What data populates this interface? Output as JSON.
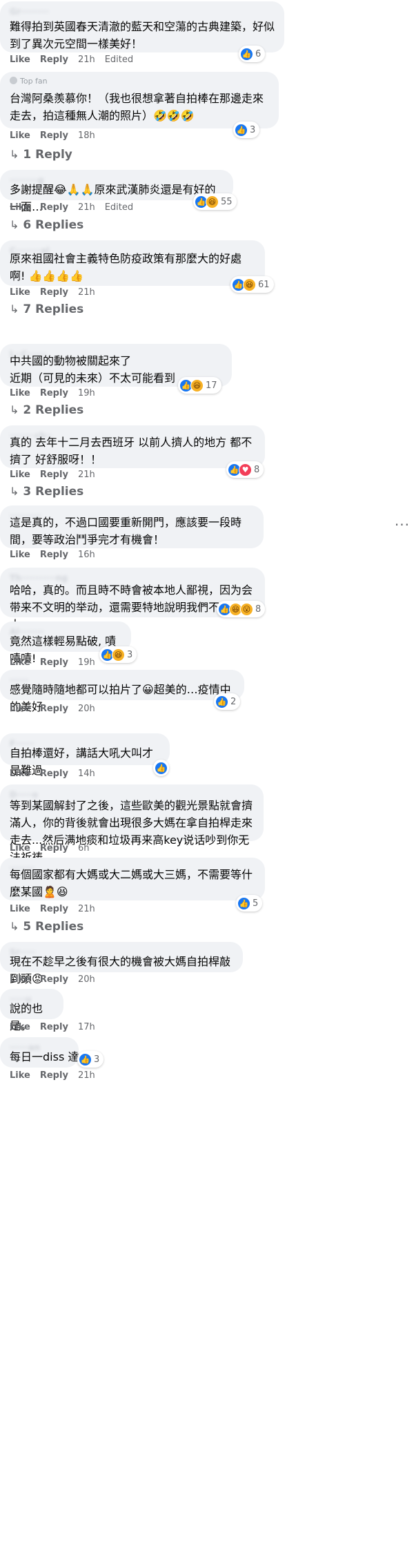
{
  "labels": {
    "like": "Like",
    "reply": "Reply"
  },
  "comments": [
    {
      "text": "難得拍到英國春天清澈的藍天和空蕩的古典建築，好似到了異次元空間一樣美好！",
      "time": "21h",
      "edited": "Edited",
      "reaction_count": "6"
    },
    {
      "badge": "Top fan",
      "text": "台灣阿桑羨慕你！（我也很想拿著自拍棒在那邊走來走去，拍這種無人潮的照片）🤣🤣🤣",
      "time": "18h",
      "reaction_count": "3",
      "replies": "1 Reply"
    },
    {
      "text": "多謝提醒😂🙏🙏原來武漢肺炎還是有好的一面…",
      "time": "21h",
      "edited": "Edited",
      "reaction_count": "55",
      "replies": "6 Replies"
    },
    {
      "text": "原來祖國社會主義特色防疫政策有那麼大的好處啊! 👍👍👍👍",
      "time": "21h",
      "reaction_count": "61",
      "replies": "7 Replies"
    },
    {
      "text": "中共國的動物被關起來了\n近期（可見的未來）不太可能看到",
      "time": "19h",
      "reaction_count": "17",
      "replies": "2 Replies"
    },
    {
      "text": "真的 去年十二月去西班牙 以前人擠人的地方 都不擠了 好舒服呀！！",
      "time": "21h",
      "reaction_count": "8",
      "replies": "3 Replies"
    },
    {
      "text": "這是真的，不過口國要重新開門，應該要一段時間，要等政治鬥爭完才有機會！",
      "time": "16h",
      "more": "···"
    },
    {
      "text": "哈哈，真的。而且時不時會被本地人鄙視，因为会带来不文明的举动，還需要特地說明我們不是腦國人。",
      "time": "21h",
      "reaction_count": "8"
    },
    {
      "text": "竟然這樣輕易點破, 嘖嘖嘖!",
      "time": "19h",
      "reaction_count": "3"
    },
    {
      "text": "感覺隨時隨地都可以拍片了😀超美的…疫情中的美好",
      "time": "20h",
      "reaction_count": "2"
    },
    {
      "text": "自拍棒還好，講話大吼大叫才是難過",
      "time": "14h"
    },
    {
      "text": "等到某國解封了之後，這些歐美的觀光景點就會擠滿人，你的背後就會出現很多大媽在拿自拍桿走來走去...然后满地痰和垃圾再来高key说话吵到你无法祈祷......",
      "time": "6h"
    },
    {
      "text": "每個國家都有大媽或大二媽或大三媽，不需要等什麼某國🙎😆",
      "time": "21h",
      "reaction_count": "5",
      "replies": "5 Replies"
    },
    {
      "text": "現在不趁早之後有很大的機會被大媽自拍桿敲到頭😡",
      "time": "20h"
    },
    {
      "text": "說的也是。",
      "time": "17h"
    },
    {
      "text": "每日一diss 達成",
      "time": "21h",
      "reaction_count": "3"
    }
  ],
  "icons": {
    "like": "like-icon",
    "haha": "haha-icon",
    "love": "love-icon",
    "wow": "wow-icon",
    "reply_arrow": "reply-arrow-icon",
    "more": "more-icon"
  },
  "colors": {
    "like_blue": "#1877f2",
    "bubble": "#f0f2f5",
    "meta_gray": "#65676b"
  }
}
